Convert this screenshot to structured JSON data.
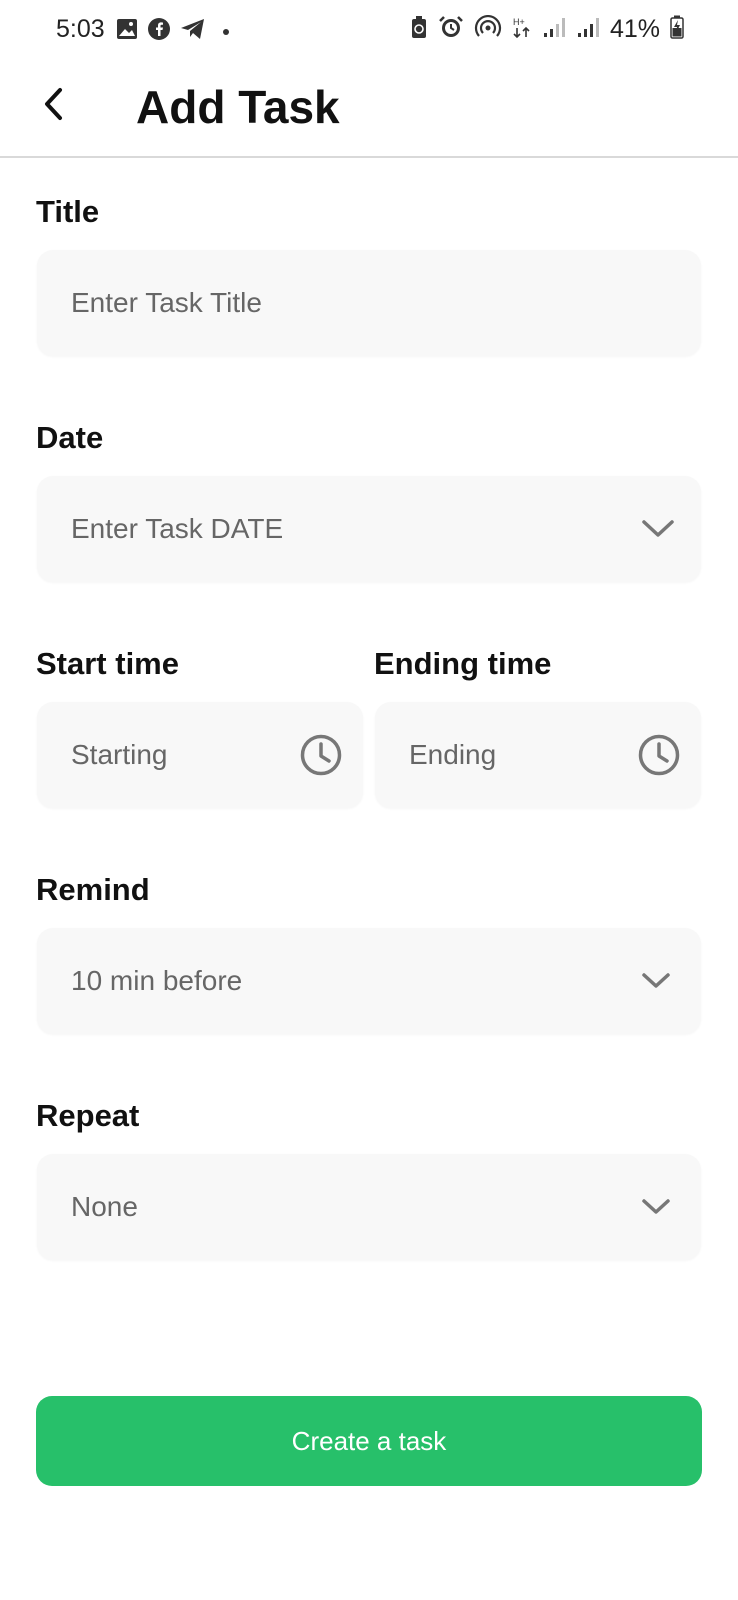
{
  "status_bar": {
    "time": "5:03",
    "battery": "41%",
    "left_icons": [
      "image-icon",
      "facebook-icon",
      "telegram-icon"
    ],
    "right_icons": [
      "battery-saver-icon",
      "alarm-icon",
      "hotspot-icon",
      "data-arrows-icon",
      "signal-icon",
      "signal-icon",
      "battery-icon"
    ]
  },
  "app_bar": {
    "title": "Add Task"
  },
  "form": {
    "title": {
      "label": "Title",
      "placeholder": "Enter Task Title"
    },
    "date": {
      "label": "Date",
      "placeholder": "Enter Task DATE"
    },
    "start_time": {
      "label": "Start time",
      "placeholder": "Starting"
    },
    "end_time": {
      "label": "Ending time",
      "placeholder": "Ending"
    },
    "remind": {
      "label": "Remind",
      "value": "10 min before"
    },
    "repeat": {
      "label": "Repeat",
      "value": "None"
    }
  },
  "actions": {
    "create_label": "Create a task"
  },
  "colors": {
    "accent": "#27c06a",
    "field_bg": "#f8f8f8",
    "icon_gray": "#777777"
  }
}
